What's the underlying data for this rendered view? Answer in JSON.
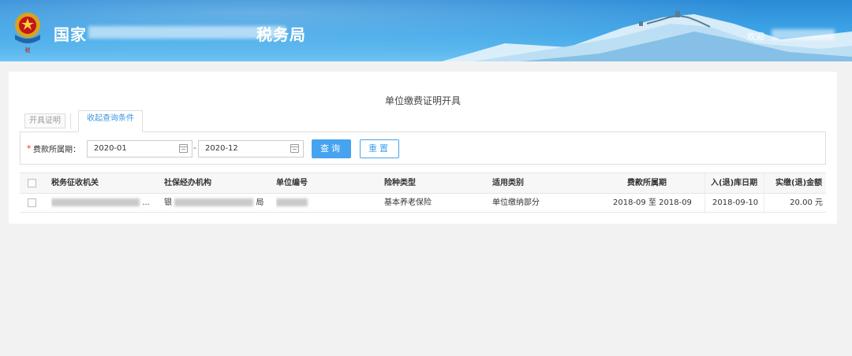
{
  "header": {
    "title_prefix": "国家",
    "title_suffix": "税务局",
    "welcome": "欢迎"
  },
  "page": {
    "title": "单位缴费证明开具"
  },
  "tabs": {
    "open_cert": "开具证明",
    "query_conditions": "收起查询条件"
  },
  "filter": {
    "required_mark": "*",
    "period_label": "费款所属期：",
    "start_value": "2020-01",
    "end_value": "2020-12",
    "separator": "-",
    "query_button": "查询",
    "reset_button": "重置"
  },
  "table": {
    "columns": [
      "税务征收机关",
      "社保经办机构",
      "单位编号",
      "险种类型",
      "适用类别",
      "费款所属期",
      "入(退)库日期",
      "实缴(退)金额"
    ],
    "rows": [
      {
        "tax_office": "",
        "tax_office_ellipsis": "...",
        "social_agency_prefix": "银",
        "social_agency_suffix": "局",
        "unit_no": "",
        "insurance_type": "基本养老保险",
        "category": "单位缴纳部分",
        "period": "2018-09 至 2018-09",
        "storage_date": "2018-09-10",
        "amount": "20.00 元"
      }
    ]
  },
  "colors": {
    "accent": "#46a3ef",
    "header_blue": "#2a8ad6",
    "required": "#e33333"
  },
  "icons": [
    "emblem-icon",
    "calendar-icon",
    "checkbox-icon"
  ]
}
